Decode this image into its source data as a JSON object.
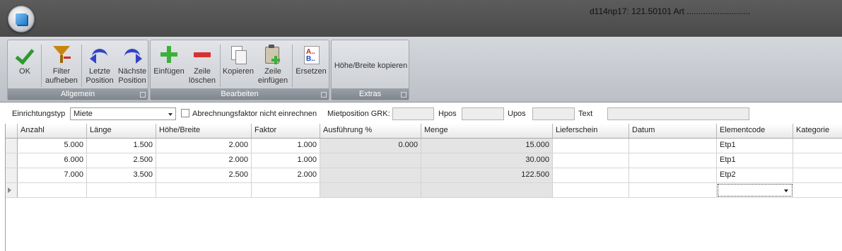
{
  "window": {
    "title": "d114np17: 121.50101 Art ..........................."
  },
  "ribbon": {
    "groups": {
      "allgemein": {
        "label": "Allgemein"
      },
      "bearbeiten": {
        "label": "Bearbeiten"
      },
      "extras": {
        "label": "Extras"
      }
    },
    "buttons": {
      "ok": "OK",
      "filter": "Filter\naufheben",
      "prev": "Letzte\nPosition",
      "next": "Nächste\nPosition",
      "insert": "Einfügen",
      "delete": "Zeile\nlöschen",
      "copy": "Kopieren",
      "paste_row": "Zeile\neinfügen",
      "replace": "Ersetzen",
      "copy_dims": "Höhe/Breite kopieren"
    }
  },
  "filterbar": {
    "type_label": "Einrichtungstyp",
    "type_value": "Miete",
    "checkbox_label": "Abrechnungsfaktor nicht einrechnen",
    "checkbox_checked": false,
    "grk_label": "Mietposition GRK:",
    "grk_value": "",
    "hpos_label": "Hpos",
    "hpos_value": "",
    "upos_label": "Upos",
    "upos_value": "",
    "text_label": "Text",
    "text_value": ""
  },
  "grid": {
    "columns": [
      "Anzahl",
      "Länge",
      "Höhe/Breite",
      "Faktor",
      "Ausführung %",
      "Menge",
      "Lieferschein",
      "Datum",
      "Elementcode",
      "Kategorie"
    ],
    "rows": [
      [
        "5.000",
        "1.500",
        "2.000",
        "1.000",
        "0.000",
        "15.000",
        "",
        "",
        "Etp1",
        ""
      ],
      [
        "6.000",
        "2.500",
        "2.000",
        "1.000",
        "",
        "30.000",
        "",
        "",
        "Etp1",
        ""
      ],
      [
        "7.000",
        "3.500",
        "2.500",
        "2.000",
        "",
        "122.500",
        "",
        "",
        "Etp2",
        ""
      ]
    ]
  }
}
